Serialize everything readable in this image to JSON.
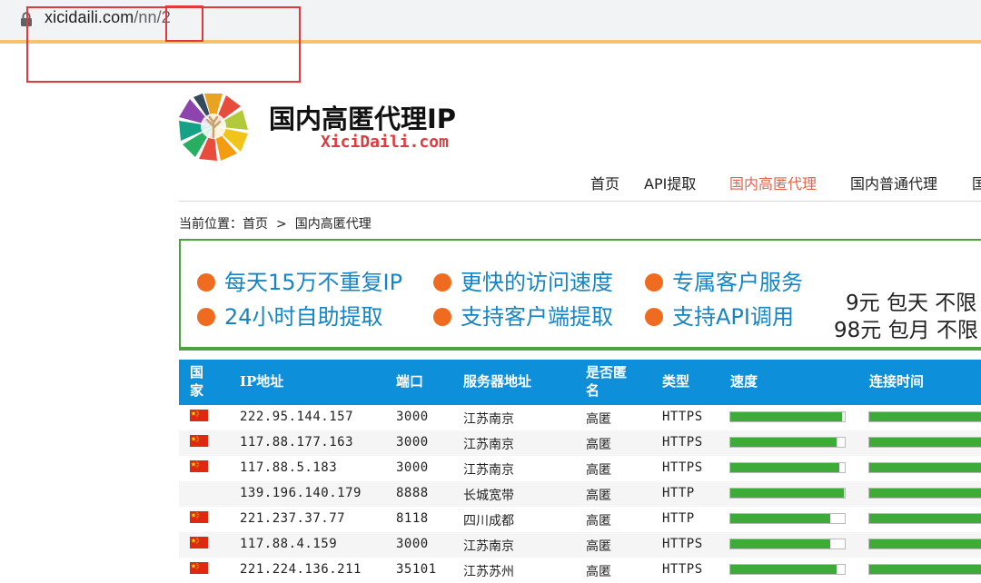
{
  "browser": {
    "url_host": "xicidaili.com",
    "url_path": "/nn/",
    "url_page": "2"
  },
  "logo": {
    "title": "国内高匿代理IP",
    "subtitle": "XiciDaili.com"
  },
  "nav": {
    "items": [
      "首页",
      "API提取",
      "国内高匿代理",
      "国内普通代理",
      "国"
    ],
    "active_index": 2,
    "active_color": "#e0644a"
  },
  "breadcrumb": {
    "prefix": "当前位置：",
    "home": "首页",
    "separator": ">",
    "current": "国内高匿代理"
  },
  "banner": {
    "features": [
      "每天15万不重复IP",
      "更快的访问速度",
      "专属客户服务",
      "24小时自助提取",
      "支持客户端提取",
      "支持API调用"
    ],
    "prices": [
      "9元 包天 不限",
      "98元 包月 不限"
    ],
    "accent_color": "#1585c5",
    "dot_color": "#ee6b1f"
  },
  "table": {
    "headers": {
      "country_line1": "国",
      "country_line2": "家",
      "ip": "IP地址",
      "port": "端口",
      "location": "服务器地址",
      "anon_line1": "是否匿",
      "anon_line2": "名",
      "type": "类型",
      "speed": "速度",
      "conn_time": "连接时间"
    },
    "rows": [
      {
        "has_flag": true,
        "ip": "222.95.144.157",
        "port": "3000",
        "location": "江苏南京",
        "anon": "高匿",
        "type": "HTTPS",
        "speed": 0.98,
        "conn": 1.0
      },
      {
        "has_flag": true,
        "ip": "117.88.177.163",
        "port": "3000",
        "location": "江苏南京",
        "anon": "高匿",
        "type": "HTTPS",
        "speed": 0.93,
        "conn": 0.96
      },
      {
        "has_flag": true,
        "ip": "117.88.5.183",
        "port": "3000",
        "location": "江苏南京",
        "anon": "高匿",
        "type": "HTTPS",
        "speed": 0.95,
        "conn": 1.0
      },
      {
        "has_flag": false,
        "ip": "139.196.140.179",
        "port": "8888",
        "location": "长城宽带",
        "anon": "高匿",
        "type": "HTTP",
        "speed": 0.99,
        "conn": 1.0
      },
      {
        "has_flag": true,
        "ip": "221.237.37.77",
        "port": "8118",
        "location": "四川成都",
        "anon": "高匿",
        "type": "HTTP",
        "speed": 0.87,
        "conn": 0.98
      },
      {
        "has_flag": true,
        "ip": "117.88.4.159",
        "port": "3000",
        "location": "江苏南京",
        "anon": "高匿",
        "type": "HTTPS",
        "speed": 0.87,
        "conn": 1.0
      },
      {
        "has_flag": true,
        "ip": "221.224.136.211",
        "port": "35101",
        "location": "江苏苏州",
        "anon": "高匿",
        "type": "HTTPS",
        "speed": 0.93,
        "conn": 1.0
      }
    ],
    "header_color": "#0e8fda",
    "bar_color": "#3eaa3a"
  }
}
